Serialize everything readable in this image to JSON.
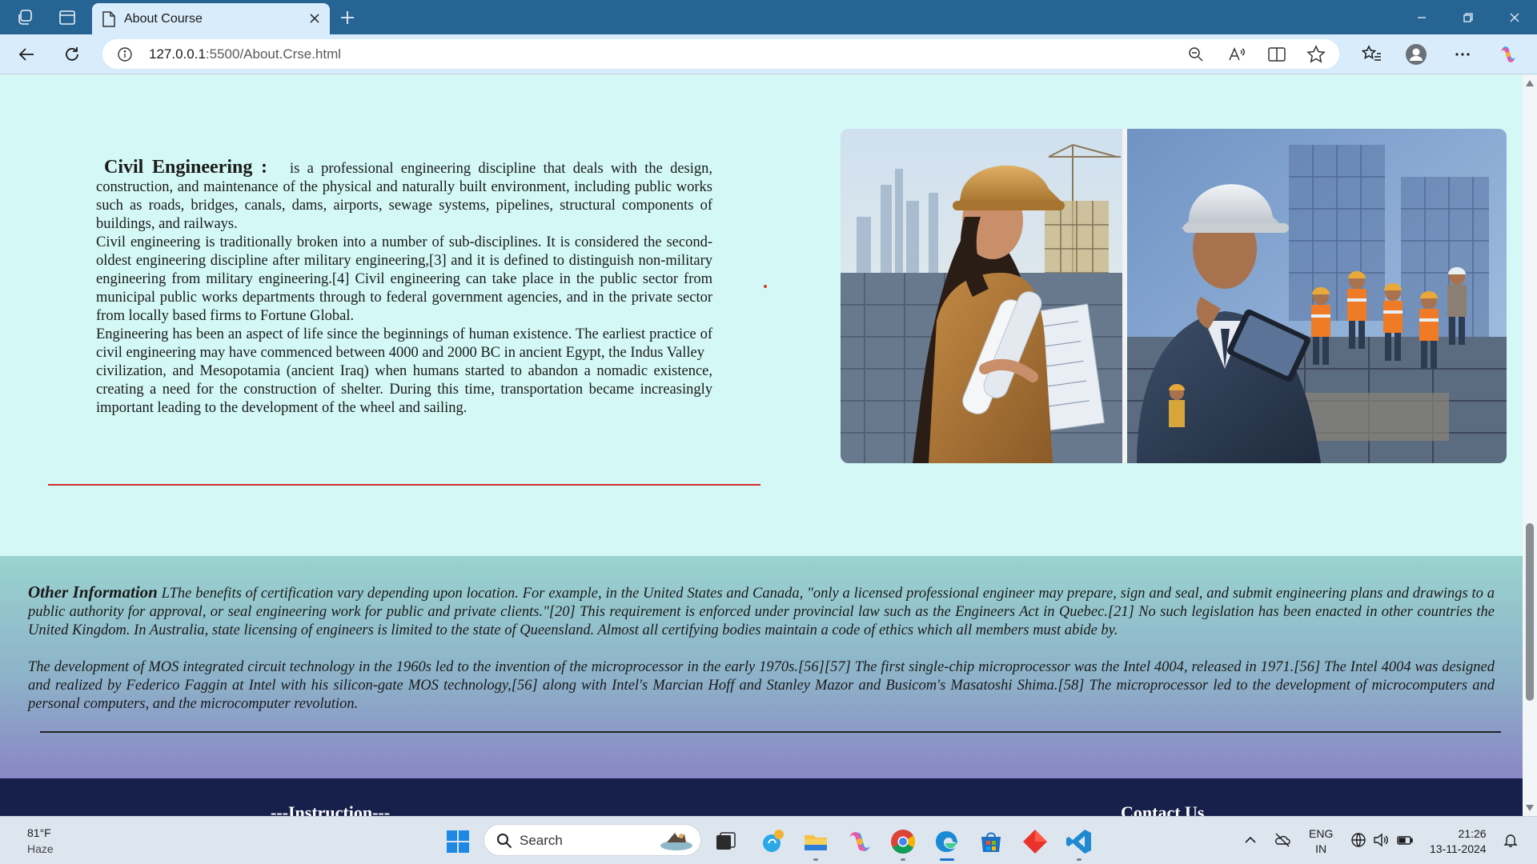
{
  "browser": {
    "tab_title": "About Course",
    "url_host": "127.0.0.1",
    "url_path": ":5500/About.Crse.html"
  },
  "page": {
    "about_title": "Civil Engineering :",
    "about_para1": "is a professional engineering discipline that deals with the design, construction, and maintenance of the physical and naturally built environment, including public works such as roads, bridges, canals, dams, airports, sewage systems, pipelines, structural components of buildings, and railways.",
    "about_para2": "Civil engineering is traditionally broken into a number of sub-disciplines. It is considered the second-oldest engineering discipline after military engineering,[3] and it is defined to distinguish non-military engineering from military engineering.[4] Civil engineering can take place in the public sector from municipal public works departments through to federal government agencies, and in the private sector from locally based firms to Fortune Global.",
    "about_para3": "Engineering has been an aspect of life since the beginnings of human existence. The earliest practice of civil engineering may have commenced between 4000 and 2000 BC in ancient Egypt, the Indus Valley",
    "about_para4": "civilization, and Mesopotamia (ancient Iraq) when humans started to abandon a nomadic existence, creating a need for the construction of shelter. During this time, transportation became increasingly important leading to the development of the wheel and sailing.",
    "other_label": "Other Information",
    "other_para1": "LThe benefits of certification vary depending upon location. For example, in the United States and Canada, \"only a licensed professional engineer may prepare, sign and seal, and submit engineering plans and drawings to a public authority for approval, or seal engineering work for public and private clients.\"[20] This requirement is enforced under provincial law such as the Engineers Act in Quebec.[21] No such legislation has been enacted in other countries the United Kingdom. In Australia, state licensing of engineers is limited to the state of Queensland. Almost all certifying bodies maintain a code of ethics which all members must abide by.",
    "other_para2": "The development of MOS integrated circuit technology in the 1960s led to the invention of the microprocessor in the early 1970s.[56][57] The first single-chip microprocessor was the Intel 4004, released in 1971.[56] The Intel 4004 was designed and realized by Federico Faggin at Intel with his silicon-gate MOS technology,[56] along with Intel's Marcian Hoff and Stanley Mazor and Busicom's Masatoshi Shima.[58] The microprocessor led to the development of microcomputers and personal computers, and the microcomputer revolution.",
    "footer_instruction": "---Instruction---",
    "footer_contact": "Contact Us"
  },
  "taskbar": {
    "temp": "81°F",
    "weather": "Haze",
    "search_label": "Search",
    "lang_line1": "ENG",
    "lang_line2": "IN",
    "time": "21:26",
    "date": "13-11-2024"
  },
  "colors": {
    "page_bg": "#d3f8f5",
    "accent_red": "#d52b2b",
    "footer_bg": "#17204a",
    "tab_bar": "#266494"
  }
}
